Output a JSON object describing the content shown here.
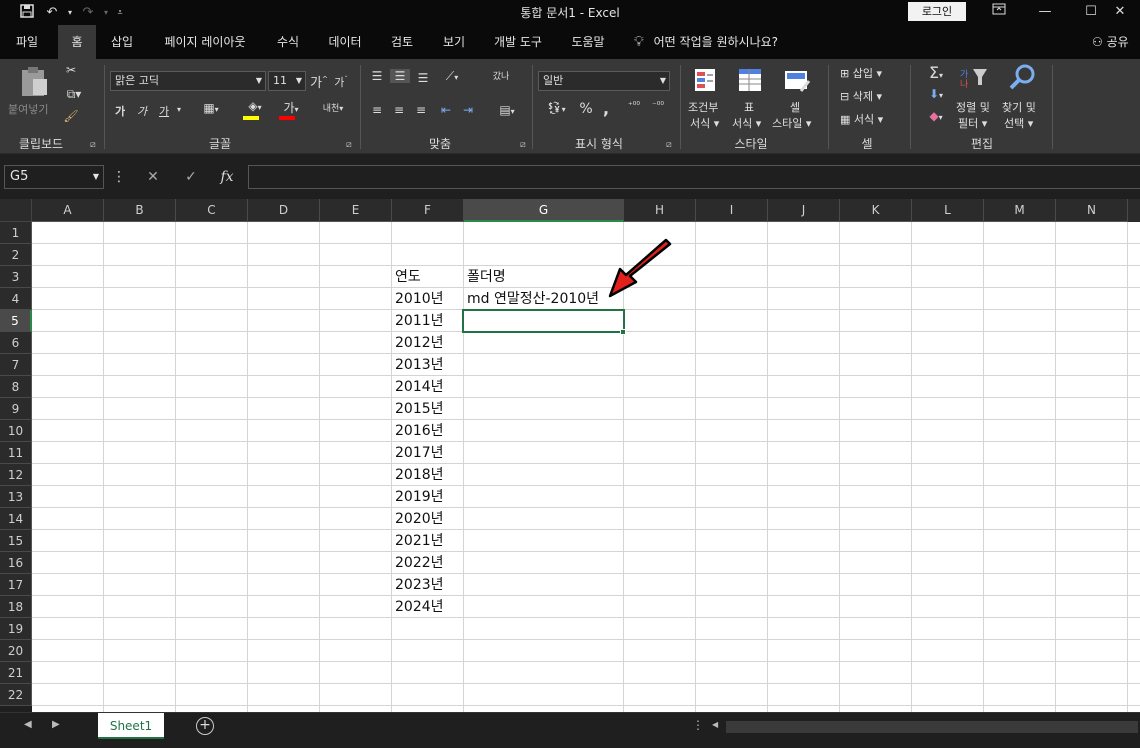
{
  "window": {
    "title": "통합 문서1  -  Excel",
    "login_label": "로그인",
    "qat": {
      "save_icon": "save-icon",
      "undo_icon": "undo-icon",
      "redo_icon": "redo-icon",
      "customize_icon": "customize-icon"
    }
  },
  "menu": {
    "tabs": [
      "파일",
      "홈",
      "삽입",
      "페이지 레이아웃",
      "수식",
      "데이터",
      "검토",
      "보기",
      "개발 도구",
      "도움말"
    ],
    "active_tab": "홈",
    "tell_me": "어떤 작업을 원하시나요?",
    "share": "공유"
  },
  "ribbon": {
    "clipboard": {
      "paste_label": "붙여넣기",
      "group_label": "클립보드"
    },
    "font": {
      "name": "맑은 고딕",
      "size": "11",
      "grow": "가",
      "shrink": "가",
      "bold": "가",
      "italic": "가",
      "underline": "가",
      "font_color_label": "가",
      "phonetic": "내천",
      "group_label": "글꼴"
    },
    "alignment": {
      "wrap": "갔나",
      "group_label": "맞춤"
    },
    "number": {
      "format": "일반",
      "percent": "%",
      "comma": ",",
      "group_label": "표시 형식"
    },
    "styles": {
      "conditional_1": "조건부",
      "conditional_2": "서식",
      "table_1": "표",
      "table_2": "서식",
      "cell_1": "셀",
      "cell_2": "스타일",
      "group_label": "스타일"
    },
    "cells": {
      "insert": "삽입",
      "delete": "삭제",
      "format": "서식",
      "group_label": "셀"
    },
    "editing": {
      "sort_1": "정렬 및",
      "sort_2": "필터",
      "find_1": "찾기 및",
      "find_2": "선택",
      "group_label": "편집"
    }
  },
  "formula_bar": {
    "name_box": "G5",
    "fx": "fx",
    "value": ""
  },
  "columns": [
    "A",
    "B",
    "C",
    "D",
    "E",
    "F",
    "G",
    "H",
    "I",
    "J",
    "K",
    "L",
    "M",
    "N"
  ],
  "selected_column": "G",
  "rows": [
    "1",
    "2",
    "3",
    "4",
    "5",
    "6",
    "7",
    "8",
    "9",
    "10",
    "11",
    "12",
    "13",
    "14",
    "15",
    "16",
    "17",
    "18",
    "19",
    "20",
    "21",
    "22"
  ],
  "selected_row": "5",
  "sheet": {
    "header_year": "연도",
    "header_folder": "폴더명",
    "first_folder": "md 연말정산-2010년",
    "years": [
      "2010년",
      "2011년",
      "2012년",
      "2013년",
      "2014년",
      "2015년",
      "2016년",
      "2017년",
      "2018년",
      "2019년",
      "2020년",
      "2021년",
      "2022년",
      "2023년",
      "2024년"
    ]
  },
  "sheet_tabs": {
    "active": "Sheet1"
  },
  "colors": {
    "accent": "#217346",
    "annotation_arrow": "#e3201b"
  }
}
